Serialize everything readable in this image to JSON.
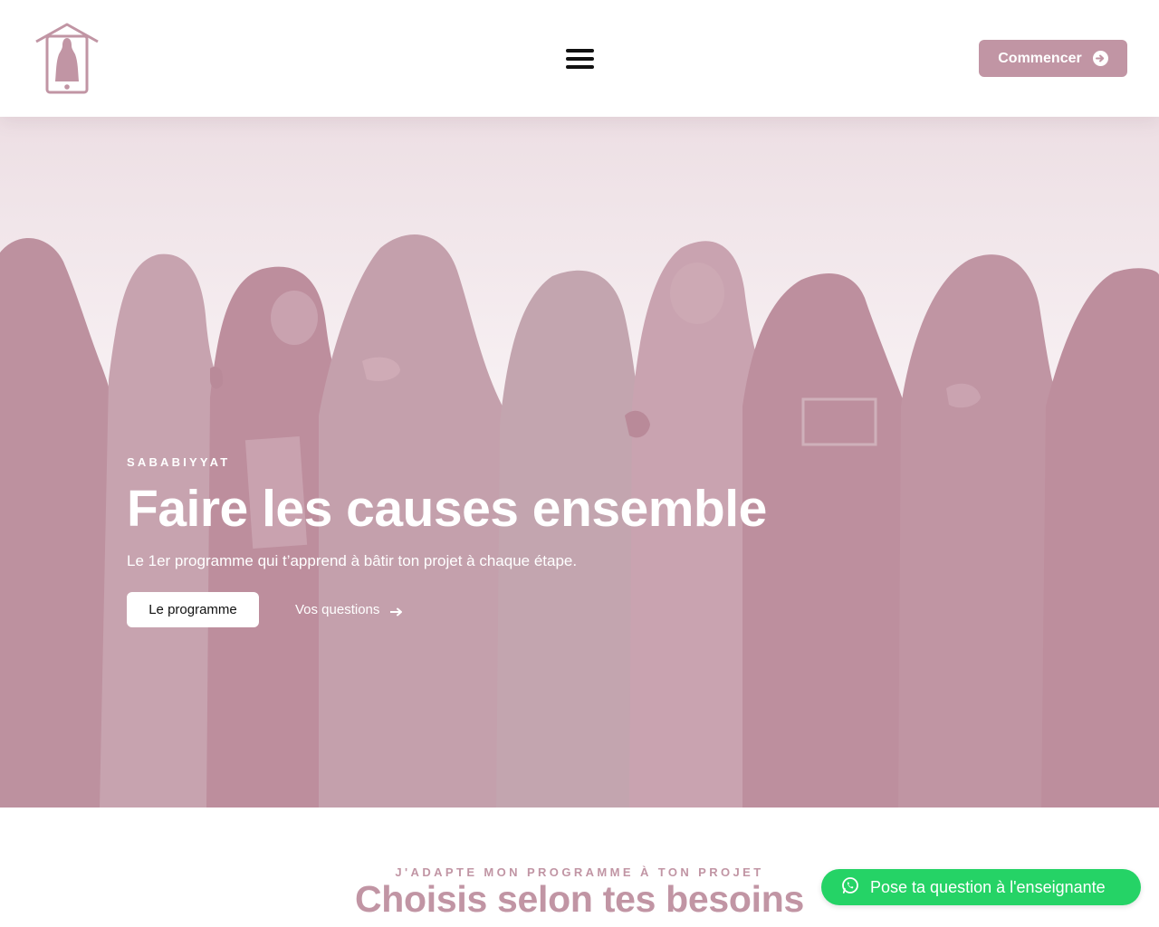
{
  "header": {
    "logo_icon": "house-woman-phone-logo-icon",
    "menu_icon": "hamburger-menu-icon",
    "cta_label": "Commencer",
    "cta_icon": "arrow-circle-right-icon"
  },
  "hero": {
    "eyebrow": "SABABIYYAT",
    "title": "Faire les causes ensemble",
    "subtitle": "Le 1er programme qui t’apprend à bâtir ton projet à chaque étape.",
    "primary_button": "Le programme",
    "secondary_button": "Vos questions",
    "secondary_icon": "arrow-right-icon"
  },
  "section": {
    "eyebrow": "J'ADAPTE MON PROGRAMME À TON PROJET",
    "title": "Choisis selon tes besoins"
  },
  "whatsapp": {
    "label": "Pose ta question à l'enseignante",
    "icon": "whatsapp-icon",
    "color": "#25d366"
  },
  "colors": {
    "brand": "#c195a4",
    "white": "#ffffff"
  }
}
